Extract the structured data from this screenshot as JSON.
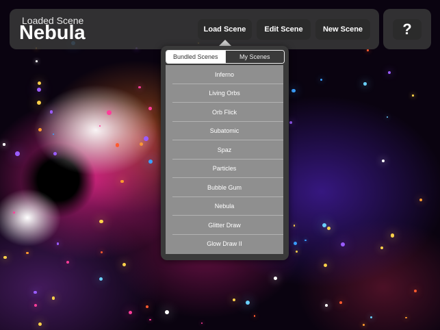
{
  "header": {
    "caption": "Loaded Scene",
    "scene_name": "Nebula",
    "buttons": {
      "load": "Load Scene",
      "edit": "Edit Scene",
      "new": "New Scene",
      "help": "?"
    }
  },
  "popover": {
    "tabs": [
      "Bundled Scenes",
      "My Scenes"
    ],
    "active_tab": "Bundled Scenes",
    "scenes": [
      "Inferno",
      "Living Orbs",
      "Orb Flick",
      "Subatomic",
      "Spaz",
      "Particles",
      "Bubble Gum",
      "Nebula",
      "Glitter Draw",
      "Glow Draw II"
    ]
  }
}
